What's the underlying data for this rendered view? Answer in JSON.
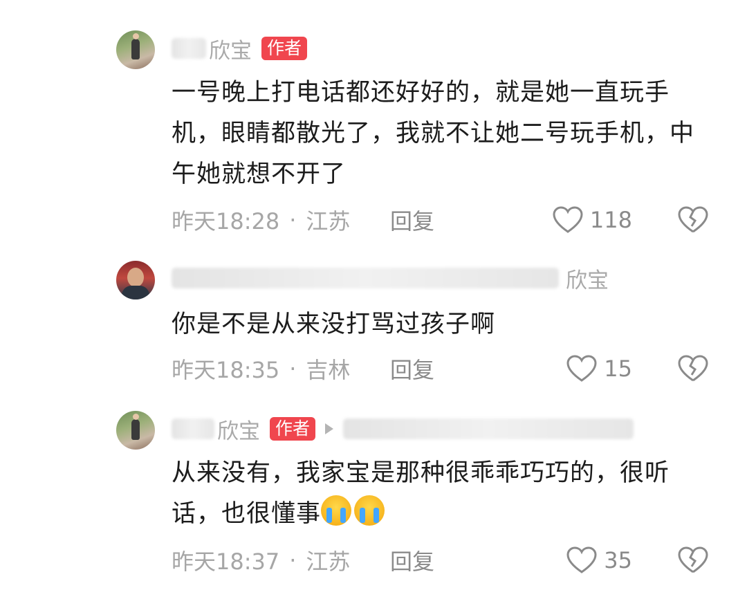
{
  "comments": [
    {
      "name": "欣宝",
      "author_badge": "作者",
      "text": "一号晚上打电话都还好好的，就是她一直玩手机，眼睛都散光了，我就不让她二号玩手机，中午她就想不开了",
      "time": "昨天18:28",
      "separator": "·",
      "location": "江苏",
      "reply_label": "回复",
      "likes": "118"
    },
    {
      "name": "欣宝",
      "text": "你是不是从来没打骂过孩子啊",
      "time": "昨天18:35",
      "separator": "·",
      "location": "吉林",
      "reply_label": "回复",
      "likes": "15"
    },
    {
      "name": "欣宝",
      "author_badge": "作者",
      "text": "从来没有，我家宝是那种很乖乖巧巧的，很听话，也很懂事",
      "emoji": "loudly-crying-face-icon",
      "time": "昨天18:37",
      "separator": "·",
      "location": "江苏",
      "reply_label": "回复",
      "likes": "35"
    }
  ]
}
